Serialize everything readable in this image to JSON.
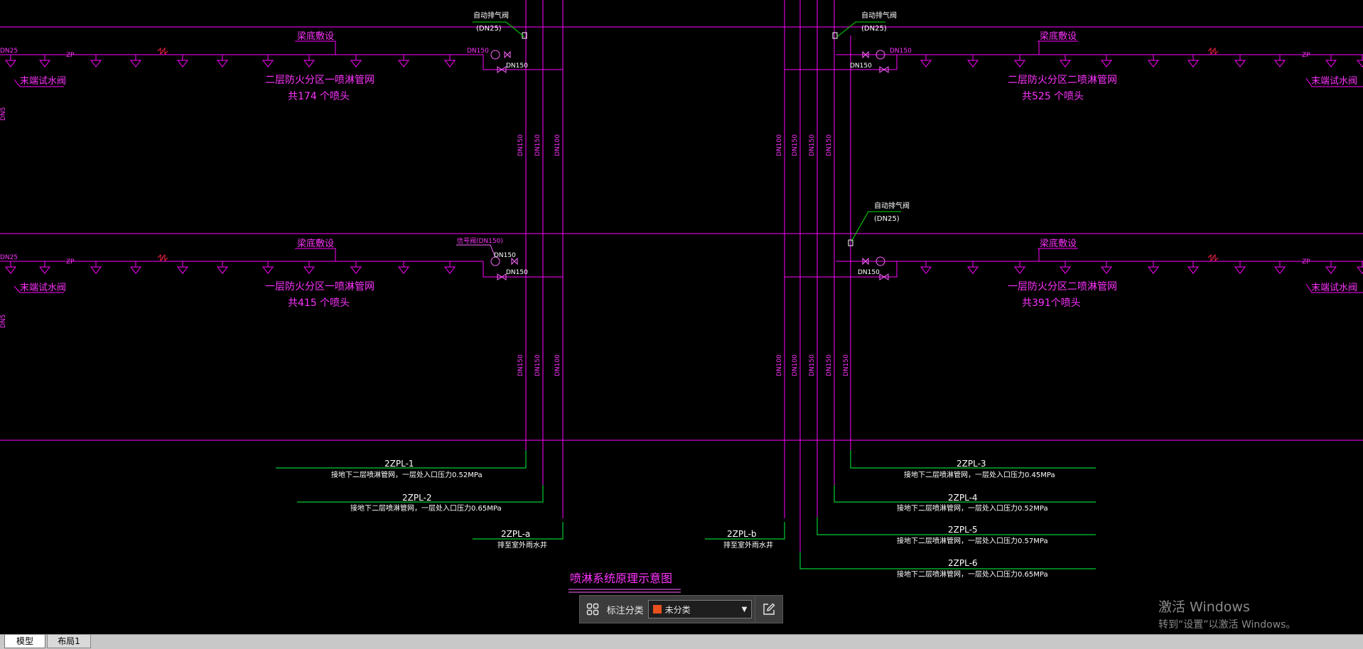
{
  "drawing": {
    "title": "喷淋系统原理示意图",
    "upper_right_valve": {
      "label": "自动排气阀",
      "size": "(DN25)"
    },
    "upper_left_valve": {
      "label": "自动排气阀",
      "size": "(DN25)"
    },
    "mid_right_valve": {
      "label": "自动排气阀",
      "size": "(DN25)"
    },
    "signal_valve_label": "信号阀(DN150)",
    "pipe_label_dn150": "DN150",
    "pipe_label_dn100": "DN100",
    "pipe_label_dn25": "DN25",
    "pipe_label_zp": "ZP",
    "pipe_label_dn5": "DN5",
    "beam_bottom": "梁底敷设",
    "end_test_valve": "末端试水阀",
    "upper_left_network": {
      "line1": "二层防火分区一喷淋管网",
      "line2": "共174 个喷头"
    },
    "upper_right_network": {
      "line1": "二层防火分区二喷淋管网",
      "line2": "共525 个喷头"
    },
    "lower_left_network": {
      "line1": "一层防火分区一喷淋管网",
      "line2": "共415 个喷头"
    },
    "lower_right_network": {
      "line1": "一层防火分区二喷淋管网",
      "line2": "共391个喷头"
    },
    "risers": [
      {
        "id": "2ZPL-1",
        "note": "接地下二层喷淋管网，一层处入口压力0.52MPa"
      },
      {
        "id": "2ZPL-2",
        "note": "接地下二层喷淋管网，一层处入口压力0.65MPa"
      },
      {
        "id": "2ZPL-a",
        "note": "排至室外雨水井"
      },
      {
        "id": "2ZPL-b",
        "note": "排至室外雨水井"
      },
      {
        "id": "2ZPL-3",
        "note": "接地下二层喷淋管网，一层处入口压力0.45MPa"
      },
      {
        "id": "2ZPL-4",
        "note": "接地下二层喷淋管网，一层处入口压力0.52MPa"
      },
      {
        "id": "2ZPL-5",
        "note": "接地下二层喷淋管网，一层处入口压力0.57MPa"
      },
      {
        "id": "2ZPL-6",
        "note": "接地下二层喷淋管网，一层处入口压力0.65MPa"
      }
    ]
  },
  "toolbar": {
    "label": "标注分类",
    "select_value": "未分类",
    "swatch_color": "#e8501e"
  },
  "activation": {
    "title": "激活 Windows",
    "subtitle": "转到“设置”以激活 Windows。"
  },
  "tabs": [
    {
      "label": "模型",
      "active": true
    },
    {
      "label": "布局1",
      "active": false
    }
  ]
}
